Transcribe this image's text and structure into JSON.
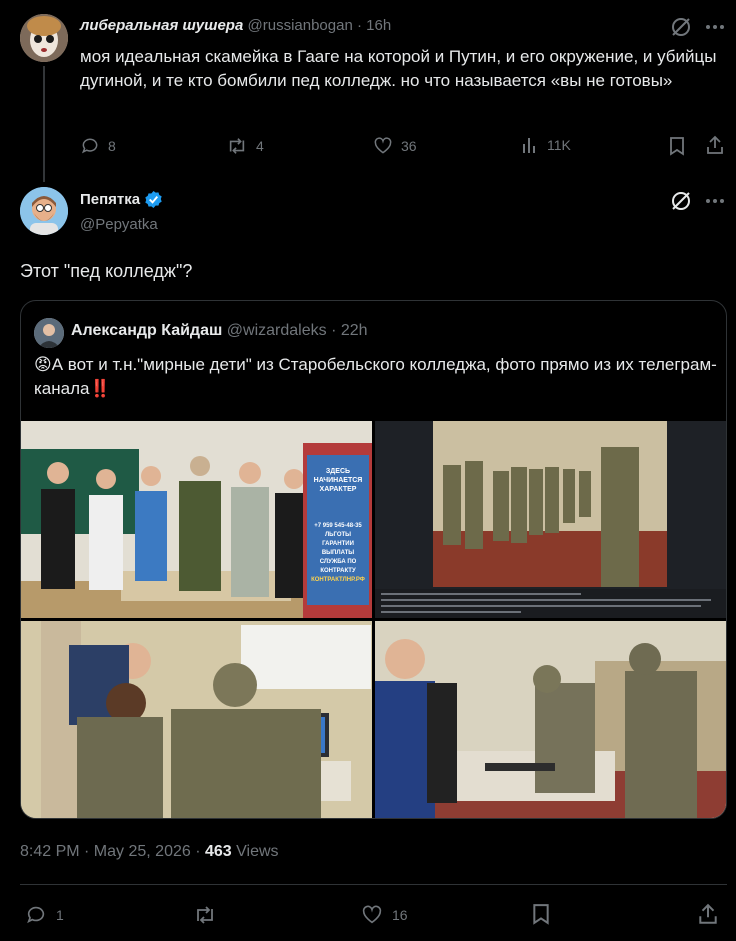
{
  "reply_tweet": {
    "author_name": "либеральная шушера",
    "handle": "@russianbogan",
    "time": "· 16h",
    "text": "моя идеальная скамейка в Гааге на которой и Путин, и его окружение, и убийцы дугиной, и те кто бомбили пед колледж. но что называется «вы не готовы»",
    "replies": "8",
    "reposts": "4",
    "likes": "36",
    "views": "11K"
  },
  "main_tweet": {
    "author_name": "Пепятка",
    "handle": "@Pepyatka",
    "text": "Этот \"пед колледж\"?",
    "timestamp": "8:42 PM · May 25, 2026 ·",
    "view_count": "463",
    "views_label": "Views",
    "replies": "1",
    "reposts": "",
    "likes": "16"
  },
  "quoted_tweet": {
    "author_name": "Александр Кайдаш",
    "handle": "@wizardaleks",
    "time": "· 22h",
    "text_prefix": "😡",
    "text": "А вот и т.н.\"мирные дети\" из Старобельского колледжа, фото прямо из их телеграм-канала",
    "text_suffix": "‼️"
  },
  "photos": {
    "banner_line1": "ЗДЕСЬ",
    "banner_line2": "НАЧИНАЕТСЯ",
    "banner_line3": "ХАРАКТЕР",
    "banner_phone": "+7 959 545-48-35",
    "banner_items": [
      "ЛЬГОТЫ",
      "ГАРАНТИИ",
      "ВЫПЛАТЫ"
    ],
    "banner_service": "СЛУЖБА ПО КОНТРАКТУ",
    "banner_site": "КОНТРАКТЛНР.РФ"
  },
  "colors": {
    "background": "#000000",
    "text": "#e7e9ea",
    "muted": "#71767b",
    "verified": "#1d9bf0",
    "border": "#2f3336"
  }
}
